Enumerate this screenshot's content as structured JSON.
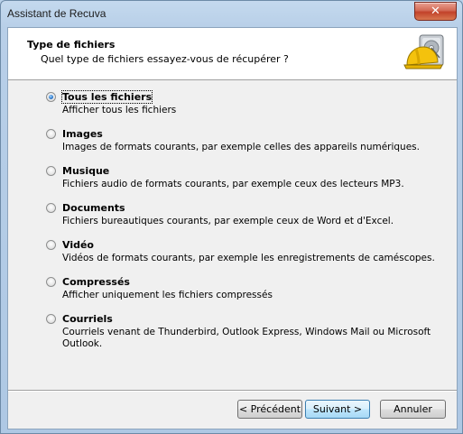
{
  "window": {
    "title": "Assistant de Recuva",
    "close_glyph": "✕"
  },
  "header": {
    "title": "Type de fichiers",
    "subtitle": "Quel type de fichiers essayez-vous de récupérer ?",
    "icon": "recuva-hardhat-drive-icon"
  },
  "options": [
    {
      "label": "Tous les fichiers",
      "description": "Afficher tous les fichiers",
      "selected": true
    },
    {
      "label": "Images",
      "description": "Images de formats courants, par exemple celles des appareils numériques.",
      "selected": false
    },
    {
      "label": "Musique",
      "description": "Fichiers audio de formats courants, par exemple ceux des lecteurs MP3.",
      "selected": false
    },
    {
      "label": "Documents",
      "description": "Fichiers bureautiques courants, par exemple ceux de Word et d'Excel.",
      "selected": false
    },
    {
      "label": "Vidéo",
      "description": "Vidéos de formats courants, par exemple les enregistrements de caméscopes.",
      "selected": false
    },
    {
      "label": "Compressés",
      "description": "Afficher uniquement les fichiers compressés",
      "selected": false
    },
    {
      "label": "Courriels",
      "description": "Courriels venant de Thunderbird, Outlook Express, Windows Mail ou Microsoft Outlook.",
      "selected": false
    }
  ],
  "buttons": {
    "back": "< Précédent",
    "next": "Suivant >",
    "cancel": "Annuler"
  },
  "colors": {
    "frame": "#b9d1ea",
    "close_button": "#c2422a",
    "default_button_border": "#3c7fb1"
  }
}
